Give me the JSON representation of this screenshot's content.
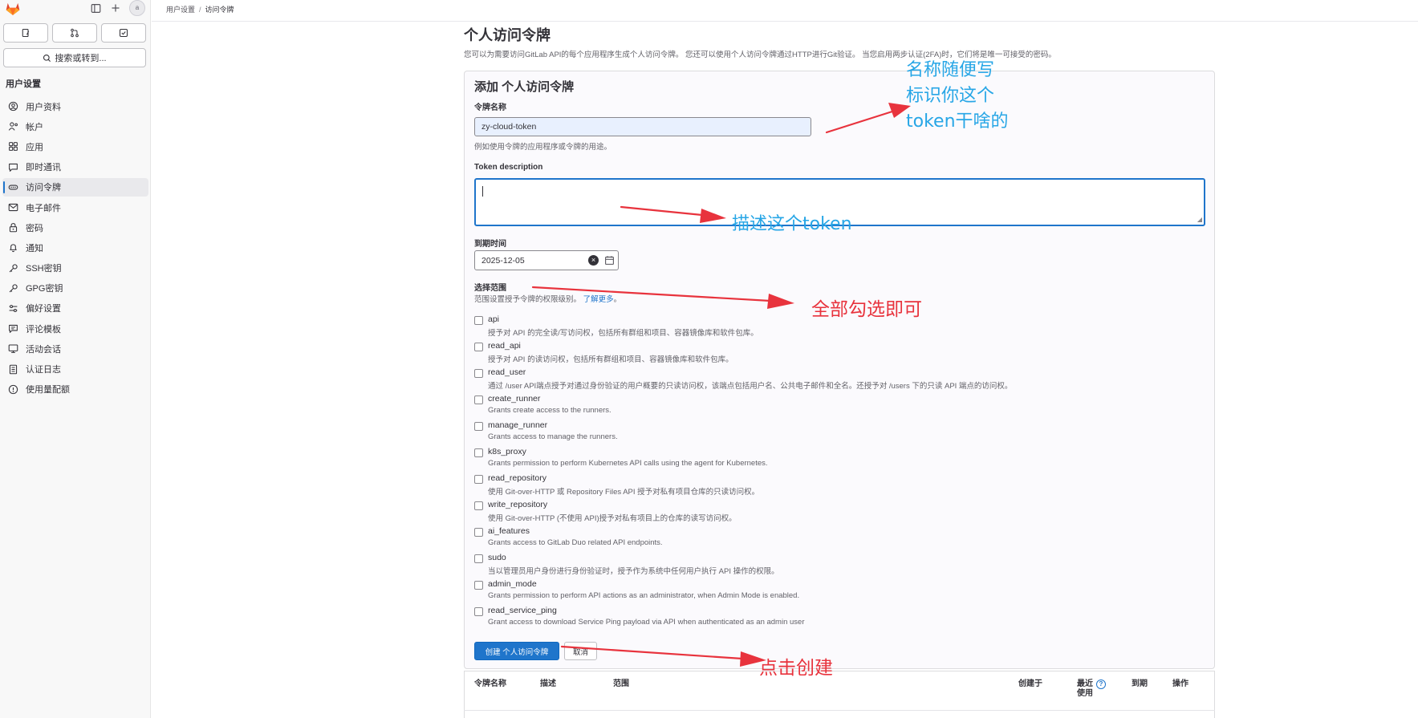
{
  "header": {
    "breadcrumb": [
      "用户设置",
      "访问令牌"
    ],
    "breadcrumb_sep": "/",
    "avatar_alt": "a"
  },
  "sidebar": {
    "search_label": "搜索或转到...",
    "section_title": "用户设置",
    "items": [
      {
        "label": "用户资料",
        "icon": "profile-icon",
        "active": false
      },
      {
        "label": "帐户",
        "icon": "account-icon",
        "active": false
      },
      {
        "label": "应用",
        "icon": "applications-icon",
        "active": false
      },
      {
        "label": "即时通讯",
        "icon": "chat-icon",
        "active": false
      },
      {
        "label": "访问令牌",
        "icon": "token-icon",
        "active": true
      },
      {
        "label": "电子邮件",
        "icon": "mail-icon",
        "active": false
      },
      {
        "label": "密码",
        "icon": "lock-icon",
        "active": false
      },
      {
        "label": "通知",
        "icon": "bell-icon",
        "active": false
      },
      {
        "label": "SSH密钥",
        "icon": "key-icon",
        "active": false
      },
      {
        "label": "GPG密钥",
        "icon": "key-icon",
        "active": false
      },
      {
        "label": "偏好设置",
        "icon": "preferences-icon",
        "active": false
      },
      {
        "label": "评论模板",
        "icon": "comment-template-icon",
        "active": false
      },
      {
        "label": "活动会话",
        "icon": "monitor-icon",
        "active": false
      },
      {
        "label": "认证日志",
        "icon": "log-icon",
        "active": false
      },
      {
        "label": "使用量配额",
        "icon": "quota-icon",
        "active": false
      }
    ]
  },
  "main": {
    "title": "个人访问令牌",
    "description": "您可以为需要访问GitLab API的每个应用程序生成个人访问令牌。 您还可以使用个人访问令牌通过HTTP进行Git验证。 当您启用两步认证(2FA)时，它们将是唯一可接受的密码。",
    "form": {
      "title": "添加 个人访问令牌",
      "name_label": "令牌名称",
      "name_value": "zy-cloud-token",
      "name_help": "例如使用令牌的应用程序或令牌的用途。",
      "desc_label": "Token description",
      "desc_value": "",
      "expiry_label": "到期时间",
      "expiry_value": "2025-12-05",
      "scopes_label": "选择范围",
      "scopes_help": "范围设置授予令牌的权限级别。",
      "scopes_help_link": "了解更多",
      "scopes_help_end": "。",
      "scopes": [
        {
          "name": "api",
          "desc": "授予对 API 的完全读/写访问权，包括所有群组和项目、容器镜像库和软件包库。",
          "checked": false
        },
        {
          "name": "read_api",
          "desc": "授予对 API 的读访问权，包括所有群组和项目、容器镜像库和软件包库。",
          "checked": false
        },
        {
          "name": "read_user",
          "desc": "通过 /user API端点授予对通过身份验证的用户概要的只读访问权，该端点包括用户名、公共电子邮件和全名。还授予对 /users 下的只读 API 端点的访问权。",
          "checked": false
        },
        {
          "name": "create_runner",
          "desc": "Grants create access to the runners.",
          "checked": false
        },
        {
          "name": "manage_runner",
          "desc": "Grants access to manage the runners.",
          "checked": false
        },
        {
          "name": "k8s_proxy",
          "desc": "Grants permission to perform Kubernetes API calls using the agent for Kubernetes.",
          "checked": false
        },
        {
          "name": "read_repository",
          "desc": "使用 Git-over-HTTP 或 Repository Files API 授予对私有项目仓库的只读访问权。",
          "checked": false
        },
        {
          "name": "write_repository",
          "desc": "使用 Git-over-HTTP (不使用 API)授予对私有项目上的仓库的读写访问权。",
          "checked": false
        },
        {
          "name": "ai_features",
          "desc": "Grants access to GitLab Duo related API endpoints.",
          "checked": false
        },
        {
          "name": "sudo",
          "desc": "当以管理员用户身份进行身份验证时，授予作为系统中任何用户执行 API 操作的权限。",
          "checked": false
        },
        {
          "name": "admin_mode",
          "desc": "Grants permission to perform API actions as an administrator, when Admin Mode is enabled.",
          "checked": false
        },
        {
          "name": "read_service_ping",
          "desc": "Grant access to download Service Ping payload via API when authenticated as an admin user",
          "checked": false
        }
      ],
      "create_label": "创建 个人访问令牌",
      "cancel_label": "取消"
    },
    "table": {
      "columns": [
        "令牌名称",
        "描述",
        "范围",
        "创建于",
        "最近使用",
        "到期",
        "操作"
      ],
      "last_used_line1": "最近",
      "last_used_line2": "使用",
      "help_glyph": "?"
    }
  },
  "annotations": {
    "name_note_lines": [
      "名称随便写",
      "标识你这个",
      "token干啥的"
    ],
    "desc_note": "描述这个token",
    "scopes_note": "全部勾选即可",
    "create_note": "点击创建",
    "colors": {
      "blue": "#27a6e6",
      "red": "#e8333d"
    }
  },
  "colors": {
    "accent": "#1f75cb",
    "sidebar_bg": "#f8f8f8",
    "active_item_bg": "#e9e9ec"
  }
}
